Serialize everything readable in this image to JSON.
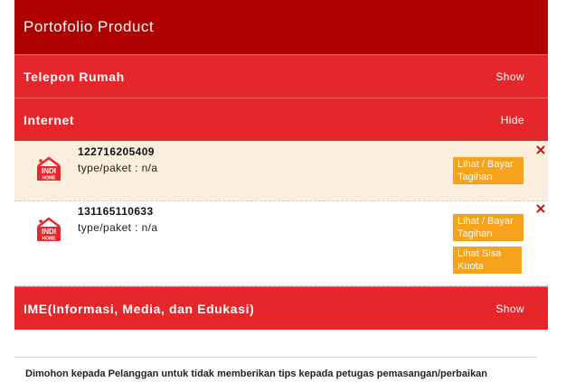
{
  "header": {
    "title": "Portofolio Product"
  },
  "sections": {
    "telepon": {
      "title": "Telepon Rumah",
      "toggle": "Show"
    },
    "internet": {
      "title": "Internet",
      "toggle": "Hide"
    },
    "ime": {
      "title": "IME(Informasi, Media, dan Edukasi)",
      "toggle": "Show"
    }
  },
  "internet_items": [
    {
      "number": "122716205409",
      "type": "type/paket : n/a",
      "pay_label": "Lihat / Bayar Tagihan"
    },
    {
      "number": "131165110633",
      "type": "type/paket : n/a",
      "pay_label": "Lihat / Bayar Tagihan",
      "quota_label": "Lihat Sisa Kuota"
    }
  ],
  "logo": {
    "text_top": "INDI",
    "text_bottom": "HOME",
    "color": "#e5262a"
  },
  "notice": "Dimohon kepada Pelanggan untuk tidak memberikan tips kepada petugas pemasangan/perbaikan",
  "colors": {
    "header": "#af0000",
    "section": "#e5262a",
    "button": "#f7a21b",
    "row_highlight": "#fbeedd"
  }
}
